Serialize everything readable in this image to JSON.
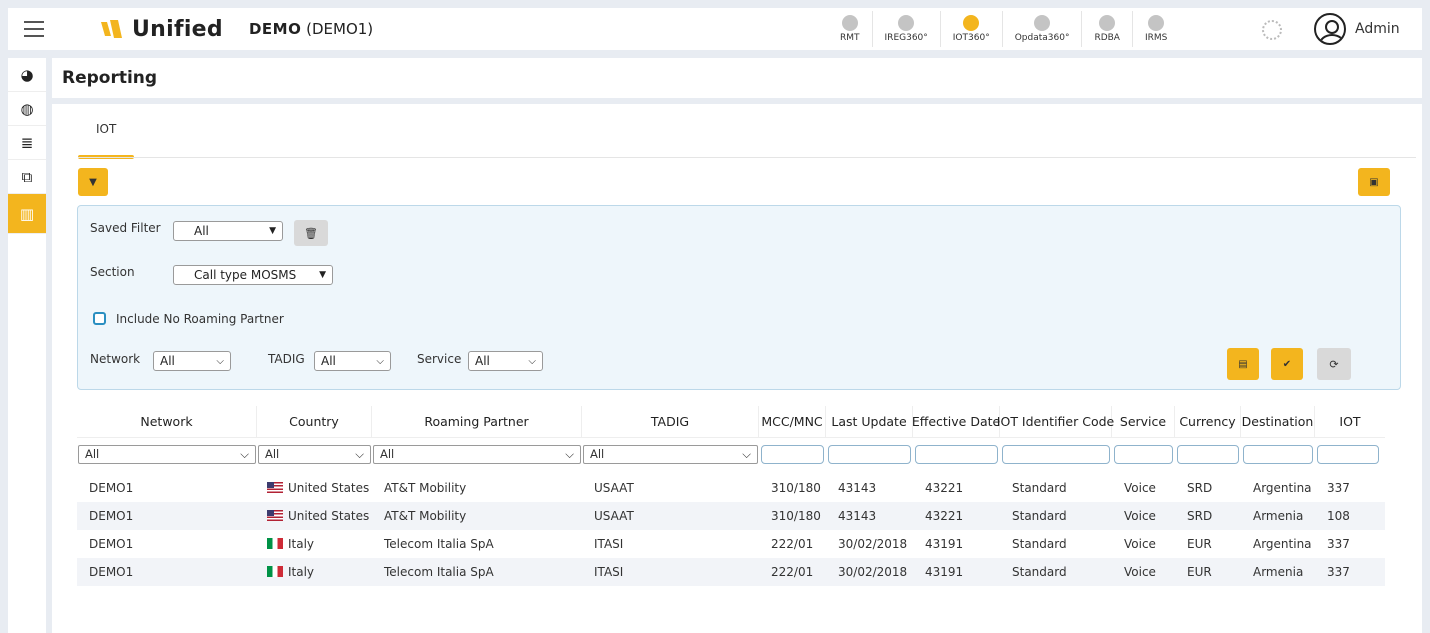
{
  "header": {
    "logo_text": "Unified",
    "tenant_name": "DEMO",
    "tenant_code": "(DEMO1)",
    "apps": [
      {
        "label": "RMT",
        "icon": "rmt-icon"
      },
      {
        "label": "IREG360°",
        "icon": "ireg-icon"
      },
      {
        "label": "IOT360°",
        "icon": "iot-icon",
        "active": true
      },
      {
        "label": "Opdata360°",
        "icon": "opdata-icon"
      },
      {
        "label": "RDBA",
        "icon": "rdba-icon"
      },
      {
        "label": "IRMS",
        "icon": "irms-icon"
      }
    ],
    "user_name": "Admin"
  },
  "sidebar": {
    "items": [
      {
        "icon": "dashboard-icon",
        "glyph": "◕"
      },
      {
        "icon": "globe-icon",
        "glyph": "◍"
      },
      {
        "icon": "server-icon",
        "glyph": "≣"
      },
      {
        "icon": "copy-icon",
        "glyph": "⧉"
      },
      {
        "icon": "chart-icon",
        "glyph": "▥",
        "active": true
      }
    ]
  },
  "page": {
    "title": "Reporting",
    "tab": "IOT"
  },
  "filters": {
    "saved_filter_label": "Saved Filter",
    "saved_filter_value": "All",
    "section_label": "Section",
    "section_value": "Call type MOSMS",
    "include_no_roaming_label": "Include No Roaming Partner",
    "network_label": "Network",
    "network_value": "All",
    "tadig_label": "TADIG",
    "tadig_value": "All",
    "service_label": "Service",
    "service_value": "All"
  },
  "table": {
    "columns": [
      "Network",
      "Country",
      "Roaming Partner",
      "TADIG",
      "MCC/MNC",
      "Last Update",
      "Effective Date",
      "IOT Identifier Code",
      "Service",
      "Currency",
      "Destination",
      "IOT"
    ],
    "filter_values": {
      "network": "All",
      "country": "All",
      "roaming_partner": "All",
      "tadig": "All"
    },
    "rows": [
      [
        "DEMO1",
        "United States",
        "AT&T Mobility",
        "USAAT",
        "310/180",
        "43143",
        "43221",
        "Standard",
        "Voice",
        "SRD",
        "Argentina",
        "337"
      ],
      [
        "DEMO1",
        "United States",
        "AT&T Mobility",
        "USAAT",
        "310/180",
        "43143",
        "43221",
        "Standard",
        "Voice",
        "SRD",
        "Armenia",
        "108"
      ],
      [
        "DEMO1",
        "Italy",
        "Telecom Italia SpA",
        "ITASI",
        "222/01",
        "30/02/2018",
        "43191",
        "Standard",
        "Voice",
        "EUR",
        "Argentina",
        "337"
      ],
      [
        "DEMO1",
        "Italy",
        "Telecom Italia SpA",
        "ITASI",
        "222/01",
        "30/02/2018",
        "43191",
        "Standard",
        "Voice",
        "EUR",
        "Armenia",
        "337"
      ]
    ]
  },
  "colors": {
    "accent": "#f3b51e",
    "panel_bg": "#eef6fb",
    "panel_border": "#bcd8e9"
  }
}
